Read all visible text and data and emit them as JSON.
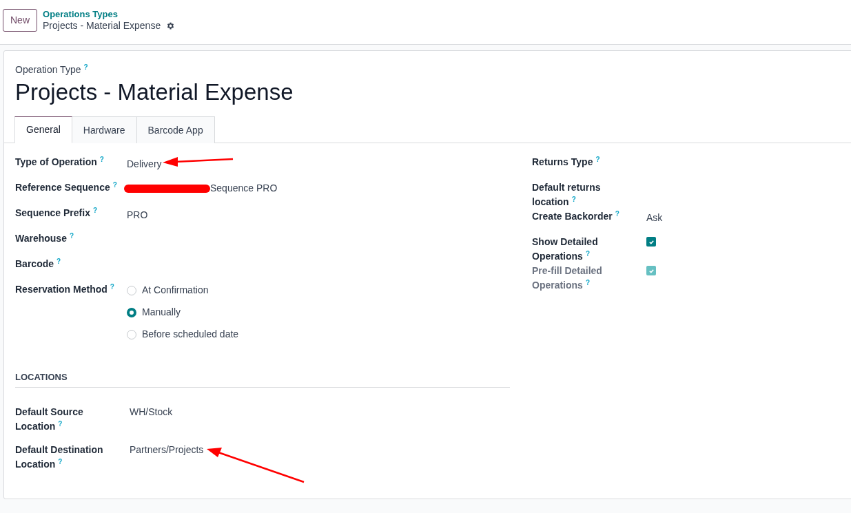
{
  "control_panel": {
    "new_button": "New",
    "breadcrumb": "Operations Types",
    "record_name": "Projects - Material Expense"
  },
  "form": {
    "overline": "Operation Type",
    "overline_help": "?",
    "title": "Projects - Material Expense",
    "tabs": [
      {
        "label": "General",
        "selected": true
      },
      {
        "label": "Hardware",
        "selected": false
      },
      {
        "label": "Barcode App",
        "selected": false
      }
    ],
    "left_fields": [
      {
        "kind": "text",
        "label": "Type of Operation",
        "help": "?",
        "value": "Delivery"
      },
      {
        "kind": "redacted",
        "label": "Reference Sequence",
        "help": "?",
        "value": "Sequence PRO"
      },
      {
        "kind": "text",
        "label": "Sequence Prefix",
        "help": "?",
        "value": "PRO"
      },
      {
        "kind": "text",
        "label": "Warehouse",
        "help": "?"
      },
      {
        "kind": "text",
        "label": "Barcode",
        "help": "?"
      },
      {
        "kind": "radio",
        "label": "Reservation Method",
        "help": "?",
        "options": [
          {
            "label": "At Confirmation",
            "selected": false
          },
          {
            "label": "Manually",
            "selected": true
          },
          {
            "label": "Before scheduled date",
            "selected": false
          }
        ]
      }
    ],
    "right_fields": [
      {
        "kind": "text",
        "label": "Returns Type",
        "help": "?",
        "disabled": false
      },
      {
        "kind": "text",
        "label": "Default returns location",
        "help": "?",
        "disabled": false
      },
      {
        "kind": "text",
        "label": "Create Backorder",
        "help": "?",
        "value": "Ask",
        "disabled": false
      },
      {
        "kind": "checkbox",
        "label": "Show Detailed Operations",
        "help": "?",
        "checked": true,
        "disabled": false
      },
      {
        "kind": "checkbox",
        "label": "Pre-fill Detailed Operations",
        "help": "?",
        "checked": true,
        "disabled": true
      }
    ],
    "locations": {
      "heading": "LOCATIONS",
      "fields": [
        {
          "label": "Default Source Location",
          "help": "?",
          "value": "WH/Stock"
        },
        {
          "label": "Default Destination Location",
          "help": "?",
          "value": "Partners/Projects"
        }
      ]
    }
  }
}
